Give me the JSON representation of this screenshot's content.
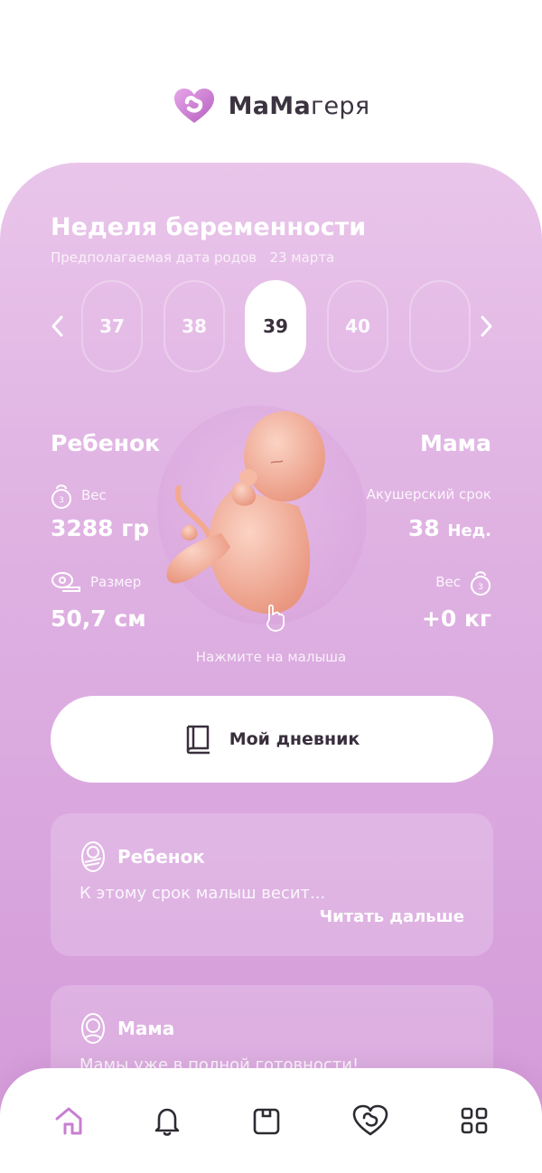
{
  "app": {
    "logo_bold": "МаМа",
    "logo_light": "геря",
    "brand_color": "#c77fd0"
  },
  "week": {
    "title": "Неделя беременности",
    "due_date_label": "Предполагаемая дата родов",
    "due_date": "23 марта",
    "weeks": [
      "37",
      "38",
      "39",
      "40",
      ""
    ],
    "selected": "39"
  },
  "baby": {
    "heading": "Ребенок",
    "weight_label": "Вес",
    "weight_value": "3288 гр",
    "size_label": "Размер",
    "size_value": "50,7 см",
    "tap_hint": "Нажмите на малыша"
  },
  "mom": {
    "heading": "Мама",
    "term_label": "Акушерский срок",
    "term_value": "38",
    "term_unit": "Нед.",
    "weight_label": "Вес",
    "weight_value": "+0 кг"
  },
  "diary": {
    "label": "Мой дневник"
  },
  "cards": [
    {
      "title": "Ребенок",
      "text": "К этому срок малыш весит...",
      "more": "Читать дальше"
    },
    {
      "title": "Мама",
      "text": "Мамы уже в полной готовности!"
    }
  ],
  "nav": {
    "icons": [
      "home-icon",
      "bell-icon",
      "calendar-icon",
      "heart-logo-icon",
      "grid-icon"
    ],
    "active_color": "#c77fd0",
    "inactive_color": "#2e2a32"
  }
}
